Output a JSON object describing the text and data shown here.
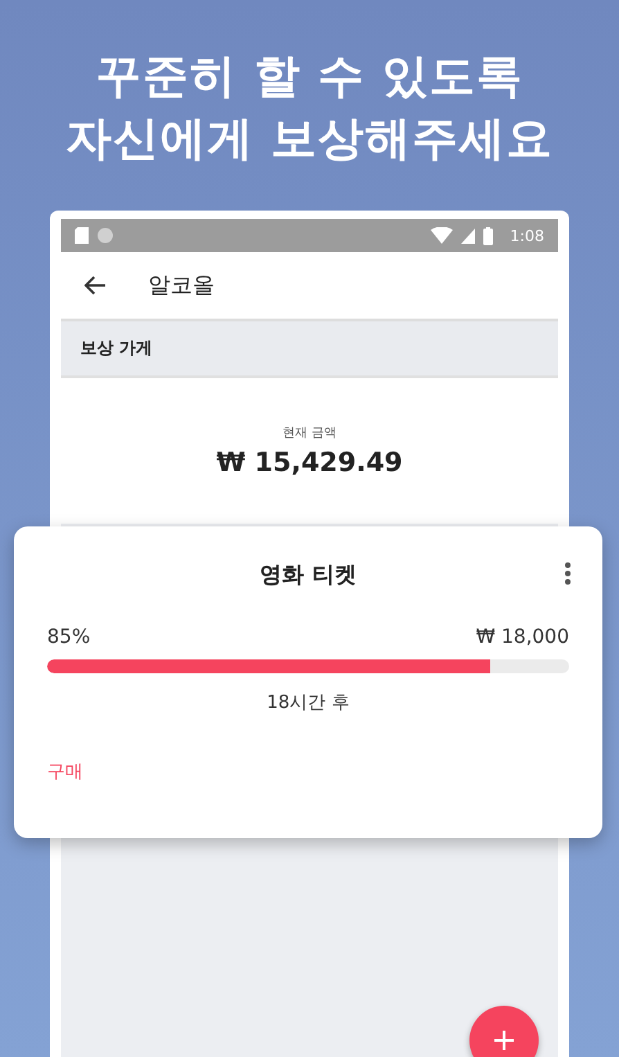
{
  "headline": [
    "꾸준히 할 수 있도록",
    "자신에게 보상해주세요"
  ],
  "status_bar": {
    "time": "1:08"
  },
  "app_bar": {
    "title": "알코올"
  },
  "section_header": "보상 가게",
  "balance": {
    "label": "현재 금액",
    "amount": "₩ 15,429.49"
  },
  "reward_card": {
    "title": "영화 티켓",
    "percent": "85%",
    "price": "₩ 18,000",
    "level": 0.85,
    "time_left": "18시간 후",
    "action": "구매"
  }
}
